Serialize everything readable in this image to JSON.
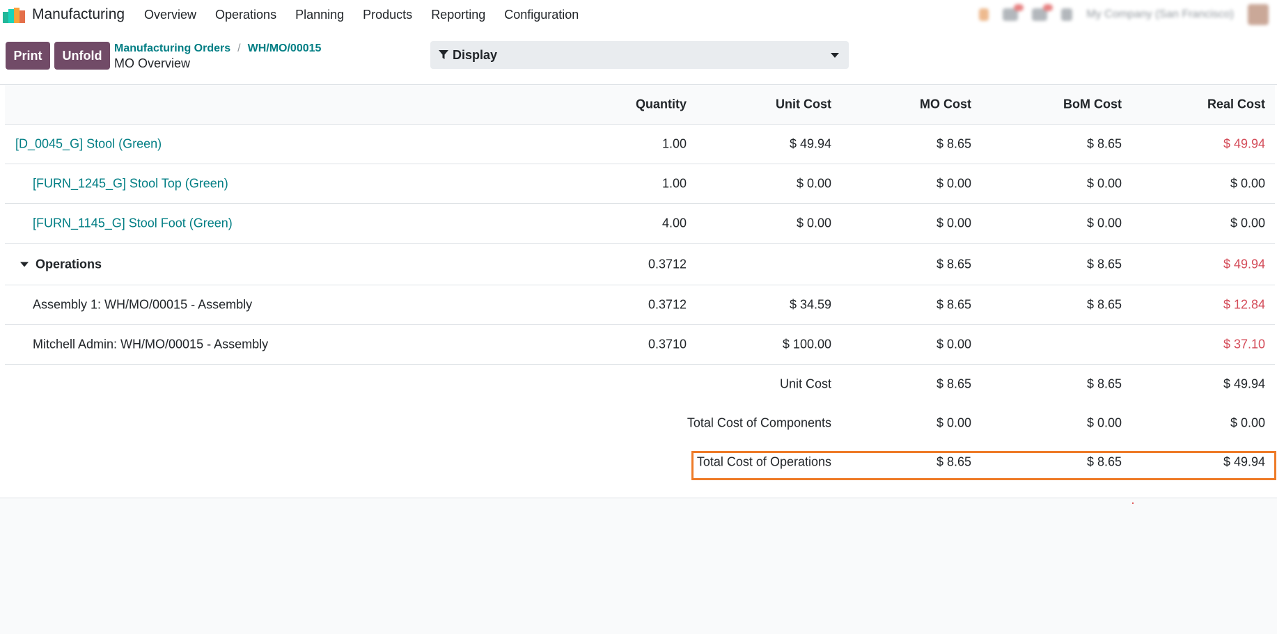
{
  "app": {
    "name": "Manufacturing"
  },
  "menu": [
    "Overview",
    "Operations",
    "Planning",
    "Products",
    "Reporting",
    "Configuration"
  ],
  "tray": {
    "company": "My Company (San Francisco)"
  },
  "buttons": {
    "print": "Print",
    "unfold": "Unfold"
  },
  "breadcrumb": {
    "parent": "Manufacturing Orders",
    "separator": "/",
    "current": "WH/MO/00015"
  },
  "page_subtitle": "MO Overview",
  "display_button": "Display",
  "table": {
    "headers": {
      "quantity": "Quantity",
      "unit_cost": "Unit Cost",
      "mo_cost": "MO Cost",
      "bom_cost": "BoM Cost",
      "real_cost": "Real Cost"
    },
    "rows": [
      {
        "name": "[D_0045_G] Stool (Green)",
        "qty": "1.00",
        "unit": "$ 49.94",
        "mo": "$ 8.65",
        "bom": "$ 8.65",
        "real": "$ 49.94"
      },
      {
        "name": "[FURN_1245_G] Stool Top (Green)",
        "qty": "1.00",
        "unit": "$ 0.00",
        "mo": "$ 0.00",
        "bom": "$ 0.00",
        "real": "$ 0.00"
      },
      {
        "name": "[FURN_1145_G] Stool Foot (Green)",
        "qty": "4.00",
        "unit": "$ 0.00",
        "mo": "$ 0.00",
        "bom": "$ 0.00",
        "real": "$ 0.00"
      },
      {
        "name": "Operations",
        "qty": "0.3712",
        "unit": "",
        "mo": "$ 8.65",
        "bom": "$ 8.65",
        "real": "$ 49.94"
      },
      {
        "name": "Assembly 1: WH/MO/00015 - Assembly",
        "qty": "0.3712",
        "unit": "$ 34.59",
        "mo": "$ 8.65",
        "bom": "$ 8.65",
        "real": "$ 12.84"
      },
      {
        "name": "Mitchell Admin: WH/MO/00015 - Assembly",
        "qty": "0.3710",
        "unit": "$ 100.00",
        "mo": "$ 0.00",
        "bom": "",
        "real": "$ 37.10"
      }
    ],
    "footer": [
      {
        "label": "Unit Cost",
        "mo": "$ 8.65",
        "bom": "$ 8.65",
        "real": "$ 49.94"
      },
      {
        "label": "Total Cost of Components",
        "mo": "$ 0.00",
        "bom": "$ 0.00",
        "real": "$ 0.00"
      },
      {
        "label": "Total Cost of Operations",
        "mo": "$ 8.65",
        "bom": "$ 8.65",
        "real": "$ 49.94"
      }
    ]
  },
  "colors": {
    "brand": "#714b67",
    "link": "#017e84",
    "negative": "#d44c59",
    "highlight": "#ee7b28"
  }
}
